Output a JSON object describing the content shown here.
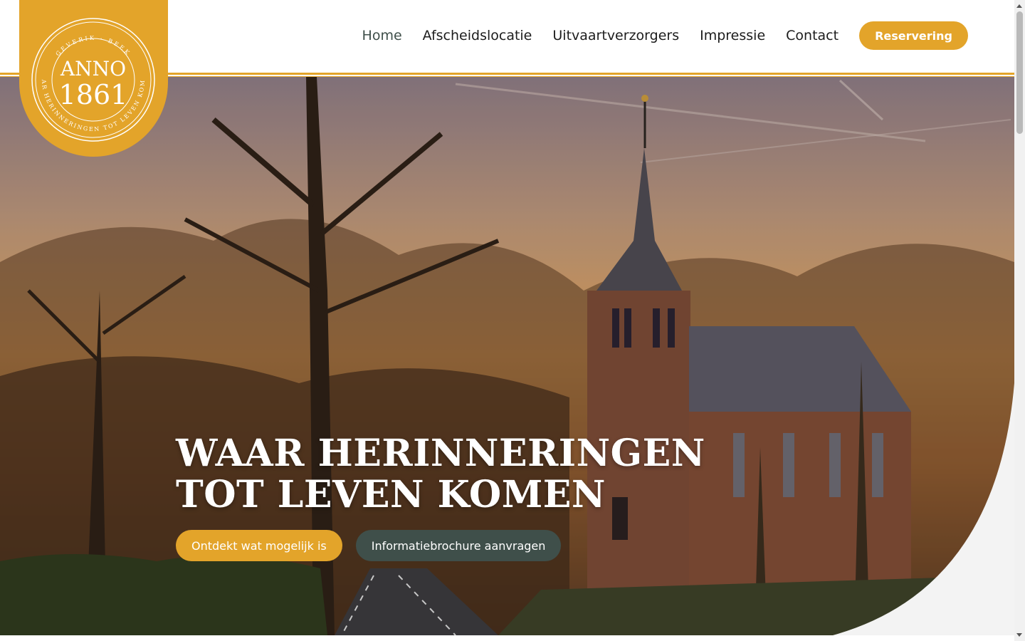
{
  "logo": {
    "top_text": "GEVERIK · BEEK",
    "bottom_text": "WAAR HERINNERINGEN TOT LEVEN KOMEN",
    "anno": "ANNO",
    "year": "1861"
  },
  "nav": {
    "items": [
      {
        "label": "Home",
        "active": true
      },
      {
        "label": "Afscheidslocatie",
        "active": false
      },
      {
        "label": "Uitvaartverzorgers",
        "active": false
      },
      {
        "label": "Impressie",
        "active": false
      },
      {
        "label": "Contact",
        "active": false
      }
    ],
    "cta_label": "Reservering"
  },
  "hero": {
    "title_line1": "WAAR HERINNERINGEN",
    "title_line2": "TOT LEVEN KOMEN",
    "primary_button": "Ontdekt wat mogelijk is",
    "secondary_button": "Informatiebrochure aanvragen"
  },
  "colors": {
    "accent": "#e3a42a",
    "dark": "#3f4f4a",
    "nav_text": "#1c1c1c"
  }
}
